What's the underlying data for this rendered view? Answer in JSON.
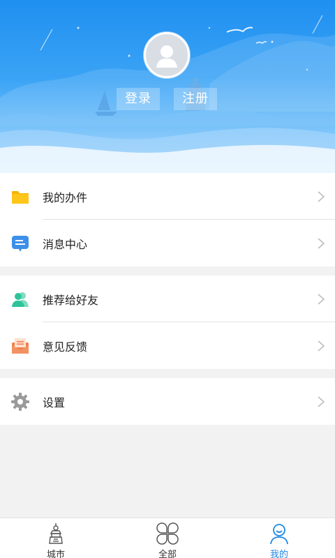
{
  "header": {
    "login_label": "登录",
    "register_label": "注册"
  },
  "menu": {
    "group1": [
      {
        "label": "我的办件",
        "icon": "folder-icon"
      },
      {
        "label": "消息中心",
        "icon": "message-icon"
      }
    ],
    "group2": [
      {
        "label": "推荐给好友",
        "icon": "friends-icon"
      },
      {
        "label": "意见反馈",
        "icon": "feedback-envelope-icon"
      }
    ],
    "group3": [
      {
        "label": "设置",
        "icon": "gear-icon"
      }
    ]
  },
  "tabbar": {
    "tabs": [
      {
        "label": "城市",
        "icon": "city-tower-icon"
      },
      {
        "label": "全部",
        "icon": "grid-petals-icon"
      },
      {
        "label": "我的",
        "icon": "person-icon",
        "active": true
      }
    ]
  },
  "colors": {
    "accent": "#1e88e5",
    "folder": "#f5b400",
    "message": "#3d8fe8",
    "friends": "#2ec39b",
    "feedback": "#f07f4e",
    "gear": "#9a9a9a"
  }
}
